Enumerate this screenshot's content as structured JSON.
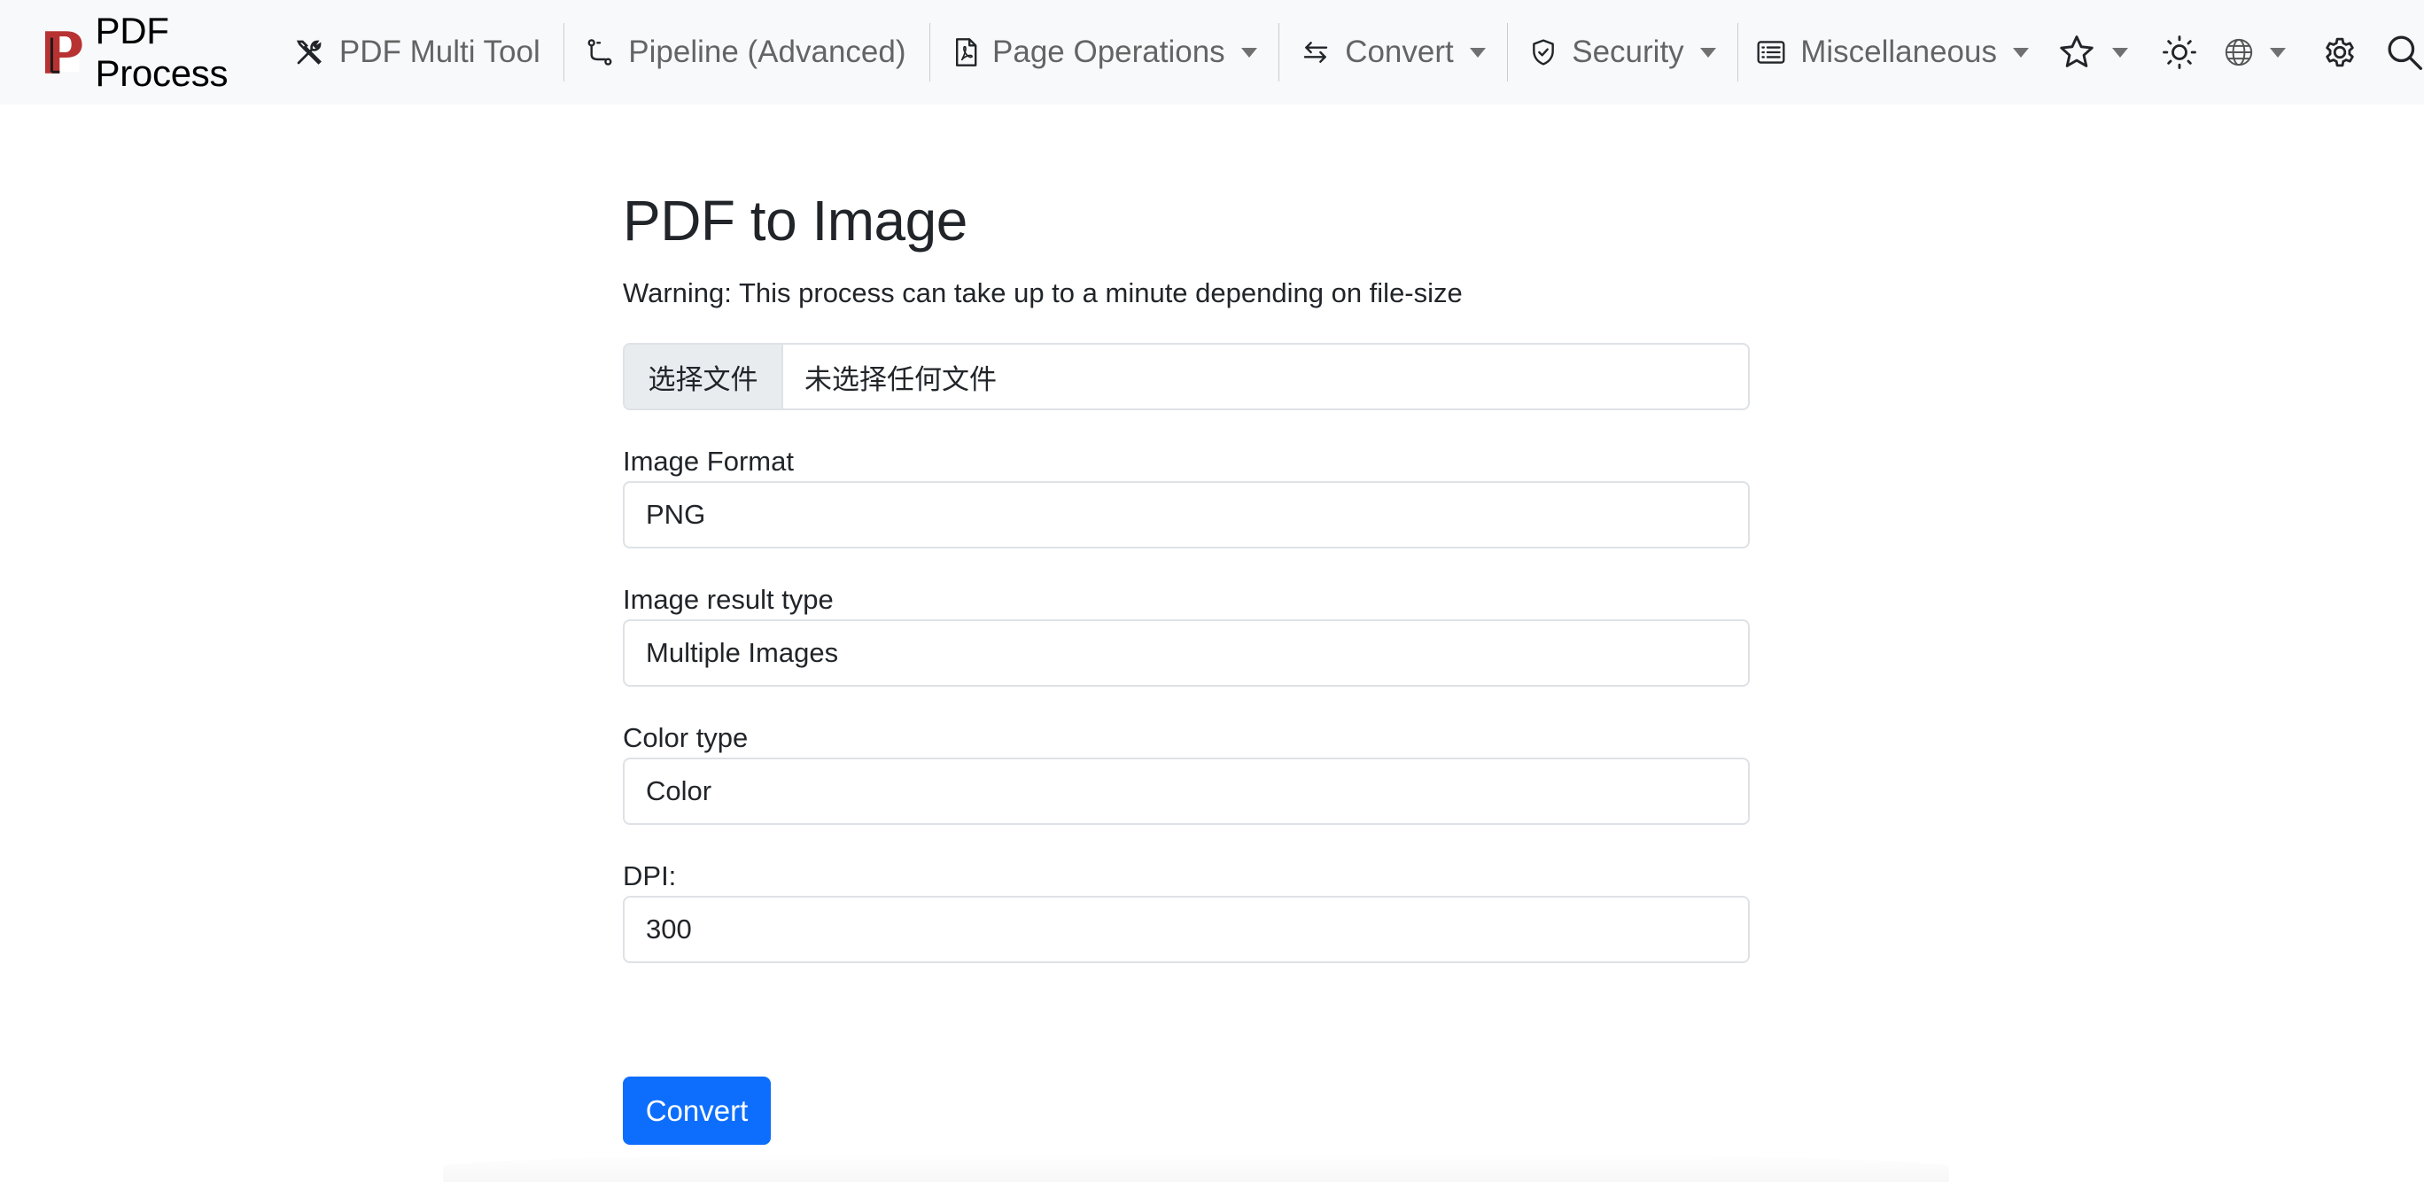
{
  "brand": {
    "name": "PDF Process",
    "logo_letter": "P",
    "logo_color": "#b83232"
  },
  "nav": {
    "items": [
      {
        "label": "PDF Multi Tool",
        "icon": "tools-icon",
        "has_caret": false
      },
      {
        "label": "Pipeline (Advanced)",
        "icon": "pipeline-icon",
        "has_caret": false
      },
      {
        "label": "Page Operations",
        "icon": "pdf-file-icon",
        "has_caret": true
      },
      {
        "label": "Convert",
        "icon": "arrows-exchange-icon",
        "has_caret": true
      },
      {
        "label": "Security",
        "icon": "shield-icon",
        "has_caret": true
      },
      {
        "label": "Miscellaneous",
        "icon": "card-list-icon",
        "has_caret": true
      }
    ],
    "right_icons": [
      "star-icon",
      "sun-icon",
      "globe-icon",
      "gear-icon",
      "search-icon"
    ]
  },
  "page": {
    "title": "PDF to Image",
    "warning": "Warning: This process can take up to a minute depending on file-size"
  },
  "file_input": {
    "button_label": "选择文件",
    "status": "未选择任何文件"
  },
  "form": {
    "image_format": {
      "label": "Image Format",
      "value": "PNG"
    },
    "result_type": {
      "label": "Image result type",
      "value": "Multiple Images"
    },
    "color_type": {
      "label": "Color type",
      "value": "Color"
    },
    "dpi": {
      "label": "DPI:",
      "value": "300"
    }
  },
  "submit": {
    "label": "Convert"
  },
  "colors": {
    "primary": "#0d6efd",
    "navbar_bg": "#f8f9fa",
    "border": "#dee2e6"
  }
}
